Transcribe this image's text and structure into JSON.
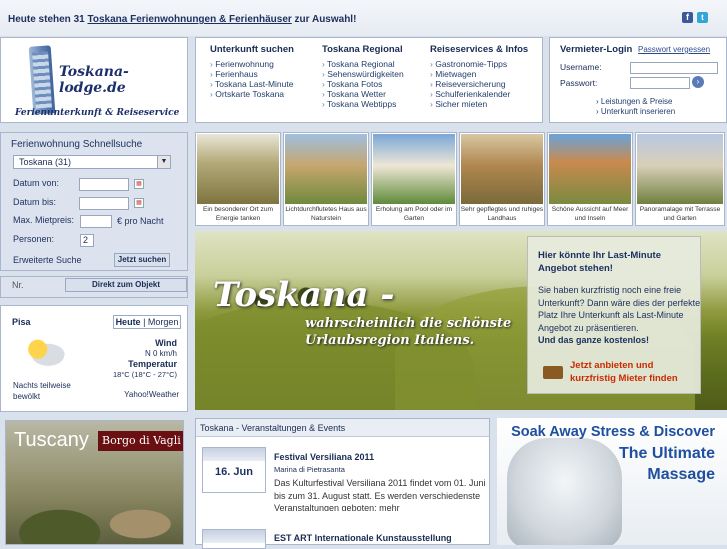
{
  "topbar": {
    "pre": "Heute stehen 31 ",
    "link": "Toskana Ferienwohnungen & Ferienhäuser",
    "post": " zur Auswahl!"
  },
  "social": {
    "facebook": "f",
    "twitter": "t"
  },
  "logo": {
    "name": "Toskana-lodge.de",
    "tagline": "Ferienunterkunft & Reiseservice"
  },
  "nav": [
    {
      "title": "Unterkunft suchen",
      "items": [
        "Ferienwohnung",
        "Ferienhaus",
        "Toskana Last-Minute",
        "Ortskarte Toskana"
      ]
    },
    {
      "title": "Toskana Regional",
      "items": [
        "Toskana Regional",
        "Sehenswürdigkeiten",
        "Toskana Fotos",
        "Toskana Wetter",
        "Toskana Webtipps"
      ]
    },
    {
      "title": "Reiseservices & Infos",
      "items": [
        "Gastronomie-Tipps",
        "Mietwagen",
        "Reiseversicherung",
        "Schulferienkalender",
        "Sicher mieten"
      ]
    }
  ],
  "login": {
    "title": "Vermieter-Login",
    "forgot": "Passwort vergessen",
    "user_label": "Username:",
    "pass_label": "Passwort:",
    "links": [
      "Leistungen & Preise",
      "Unterkunft inserieren"
    ]
  },
  "search": {
    "title": "Ferienwohnung Schnellsuche",
    "region": "Toskana (31)",
    "from": "Datum von:",
    "to": "Datum bis:",
    "price": "Max. Mietpreis:",
    "per_night": "€ pro Nacht",
    "persons": "Personen:",
    "persons_val": "2",
    "extended": "Erweiterte Suche",
    "search_btn": "Jetzt suchen"
  },
  "direct": {
    "placeholder": "Nr.",
    "button": "Direkt zum Objekt"
  },
  "weather": {
    "city": "Pisa",
    "today": "Heute",
    "tomorrow": "Morgen",
    "wind_label": "Wind",
    "wind": "N 0 km/h",
    "temp_label": "Temperatur",
    "temp": "18°C (18°C - 27°C)",
    "desc": "Nachts teilweise bewölkt",
    "credit": "Yahoo!Weather"
  },
  "photos": [
    {
      "caption": "Ein besonderer Ort zum Energie tanken",
      "color": "#8f8a55"
    },
    {
      "caption": "Lichtdurchflutetes Haus aus Naturstein",
      "color": "#6f8a3c"
    },
    {
      "caption": "Erholung am Pool oder im Garten",
      "color": "#7a9fc8"
    },
    {
      "caption": "Sehr gepflegtes und ruhiges Landhaus",
      "color": "#9a7a4e"
    },
    {
      "caption": "Schöne Aussicht auf Meer und Inseln",
      "color": "#c08a52"
    },
    {
      "caption": "Panoramalage mit Terrasse und Garten",
      "color": "#a7b6cc"
    }
  ],
  "hero": {
    "title": "Toskana -",
    "line1": "wahrscheinlich die schönste",
    "line2": "Urlaubsregion Italiens."
  },
  "lastminute": {
    "heading": "Hier könnte Ihr Last-Minute Angebot stehen!",
    "body": "Sie haben kurzfristig noch eine freie Unterkunft? Dann wäre dies der perfekte Platz Ihre Unterkunft als Last-Minute Angebot zu präsentieren.",
    "bold": "Und das ganze kostenlos!",
    "cta": "Jetzt anbieten und kurzfristig Mieter finden"
  },
  "ad_left": {
    "text1": "Tuscany",
    "text2": "Borgo di Vagli"
  },
  "events": {
    "heading": "Toskana - Veranstaltungen & Events",
    "items": [
      {
        "date": "16. Jun",
        "title": "Festival Versiliana 2011",
        "place": "Marina di Pietrasanta",
        "desc": "Das Kulturfestival Versiliana 2011 findet vom 01. Juni bis zum 31. August statt. Es werden verschiedenste Veranstaltungen geboten: mehr"
      },
      {
        "date": "",
        "title": "EST ART Internationale Kunstausstellung",
        "place": "",
        "desc": ""
      }
    ]
  },
  "ad_right": {
    "line1": "Soak Away Stress & Discover",
    "line2": "The Ultimate",
    "line3": "Massage"
  }
}
